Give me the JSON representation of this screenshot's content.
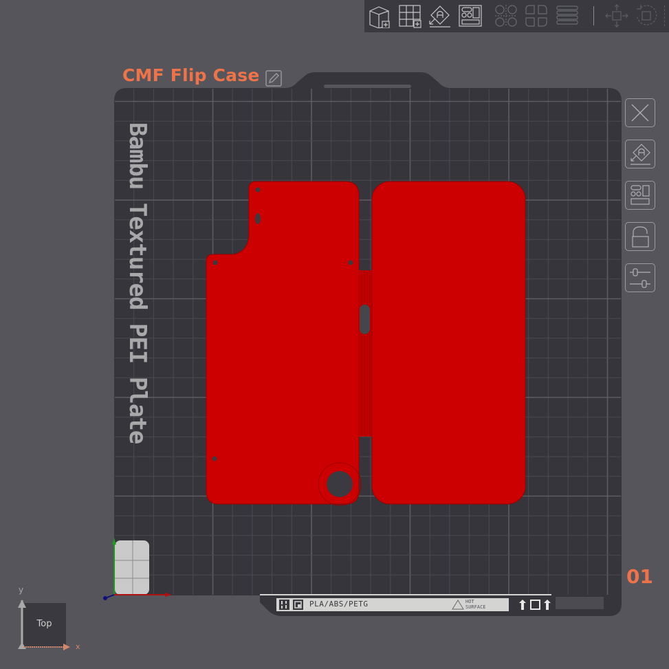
{
  "toolbar": {
    "buttons": [
      {
        "name": "add-object",
        "enabled": true
      },
      {
        "name": "add-plate",
        "enabled": true
      },
      {
        "name": "auto-orient",
        "enabled": true
      },
      {
        "name": "arrange",
        "enabled": true
      },
      {
        "name": "split-objects",
        "enabled": false
      },
      {
        "name": "split-parts",
        "enabled": false
      },
      {
        "name": "layers",
        "enabled": false
      },
      {
        "name": "move",
        "enabled": false
      },
      {
        "name": "rotate",
        "enabled": false
      }
    ]
  },
  "plate": {
    "title": "CMF Flip Case",
    "label": "Bambu Textured PEI Plate",
    "number": "01",
    "info_strip": {
      "materials": "PLA/ABS/PETG",
      "warning_line1": "HOT",
      "warning_line2": "SURFACE"
    }
  },
  "side_toolbar": {
    "buttons": [
      {
        "name": "remove-plate"
      },
      {
        "name": "auto-orient-plate"
      },
      {
        "name": "arrange-plate"
      },
      {
        "name": "lock-plate"
      },
      {
        "name": "plate-settings"
      }
    ]
  },
  "view": {
    "label": "Top",
    "axis_x": "x",
    "axis_y": "y"
  },
  "colors": {
    "accent": "#ef7349",
    "model": "#cc0000",
    "plate": "#36353b",
    "background": "#56555c"
  }
}
